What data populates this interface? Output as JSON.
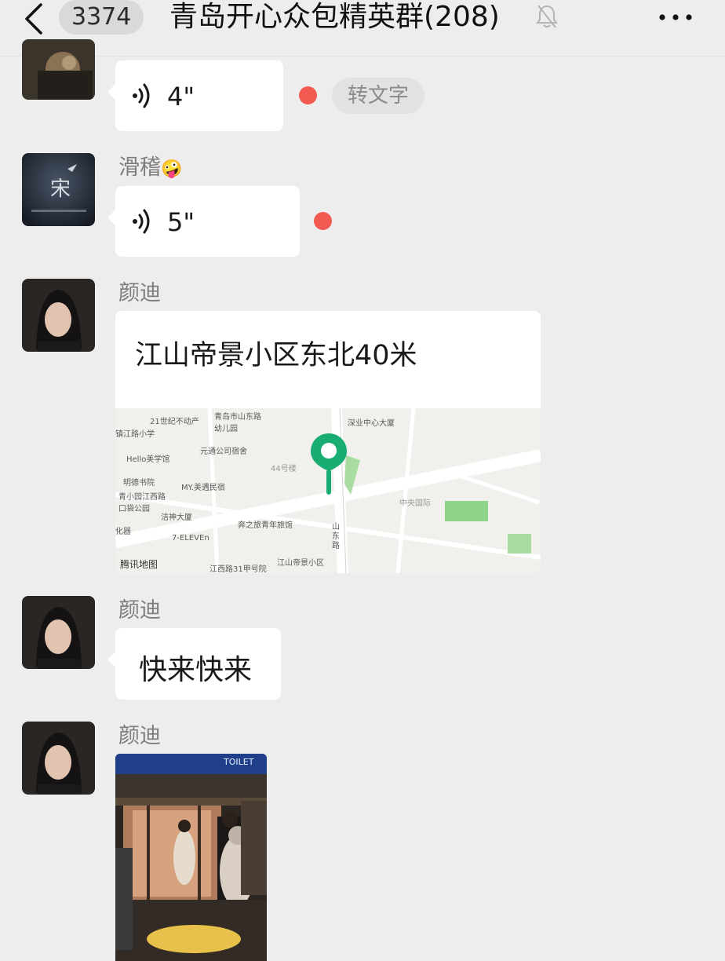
{
  "header": {
    "unread_count": "3374",
    "title": "青岛开心众包精英群(208)"
  },
  "messages": [
    {
      "type": "voice",
      "duration": "4\"",
      "unread": true,
      "convert_label": "转文字"
    },
    {
      "type": "voice",
      "sender": "滑稽",
      "sender_emoji": "🤪",
      "duration": "5\"",
      "unread": true
    },
    {
      "type": "location",
      "sender": "颜迪",
      "address": "江山帝景小区东北40米"
    },
    {
      "type": "text",
      "sender": "颜迪",
      "text": "快来快来"
    },
    {
      "type": "image",
      "sender": "颜迪",
      "sign_text": "TOILET"
    }
  ],
  "map": {
    "provider": "腾讯地图",
    "labels": [
      "21世纪不动产",
      "青岛市山东路幼儿园",
      "深业中心大厦",
      "镇江路小学",
      "元通公司宿舍",
      "Hello美学馆",
      "44号楼",
      "明德书院",
      "MY.美遇民宿",
      "青小园江西路口袋公园",
      "中央国际",
      "洁神大厦",
      "奔之旅青年旅馆",
      "7-ELEVEn",
      "山东路",
      "江西路31甲号院",
      "江山帝景小区",
      "化器"
    ]
  },
  "colors": {
    "background": "#ededed",
    "bubble": "#ffffff",
    "unread_dot": "#f25a52",
    "map_pin": "#1aad73"
  }
}
